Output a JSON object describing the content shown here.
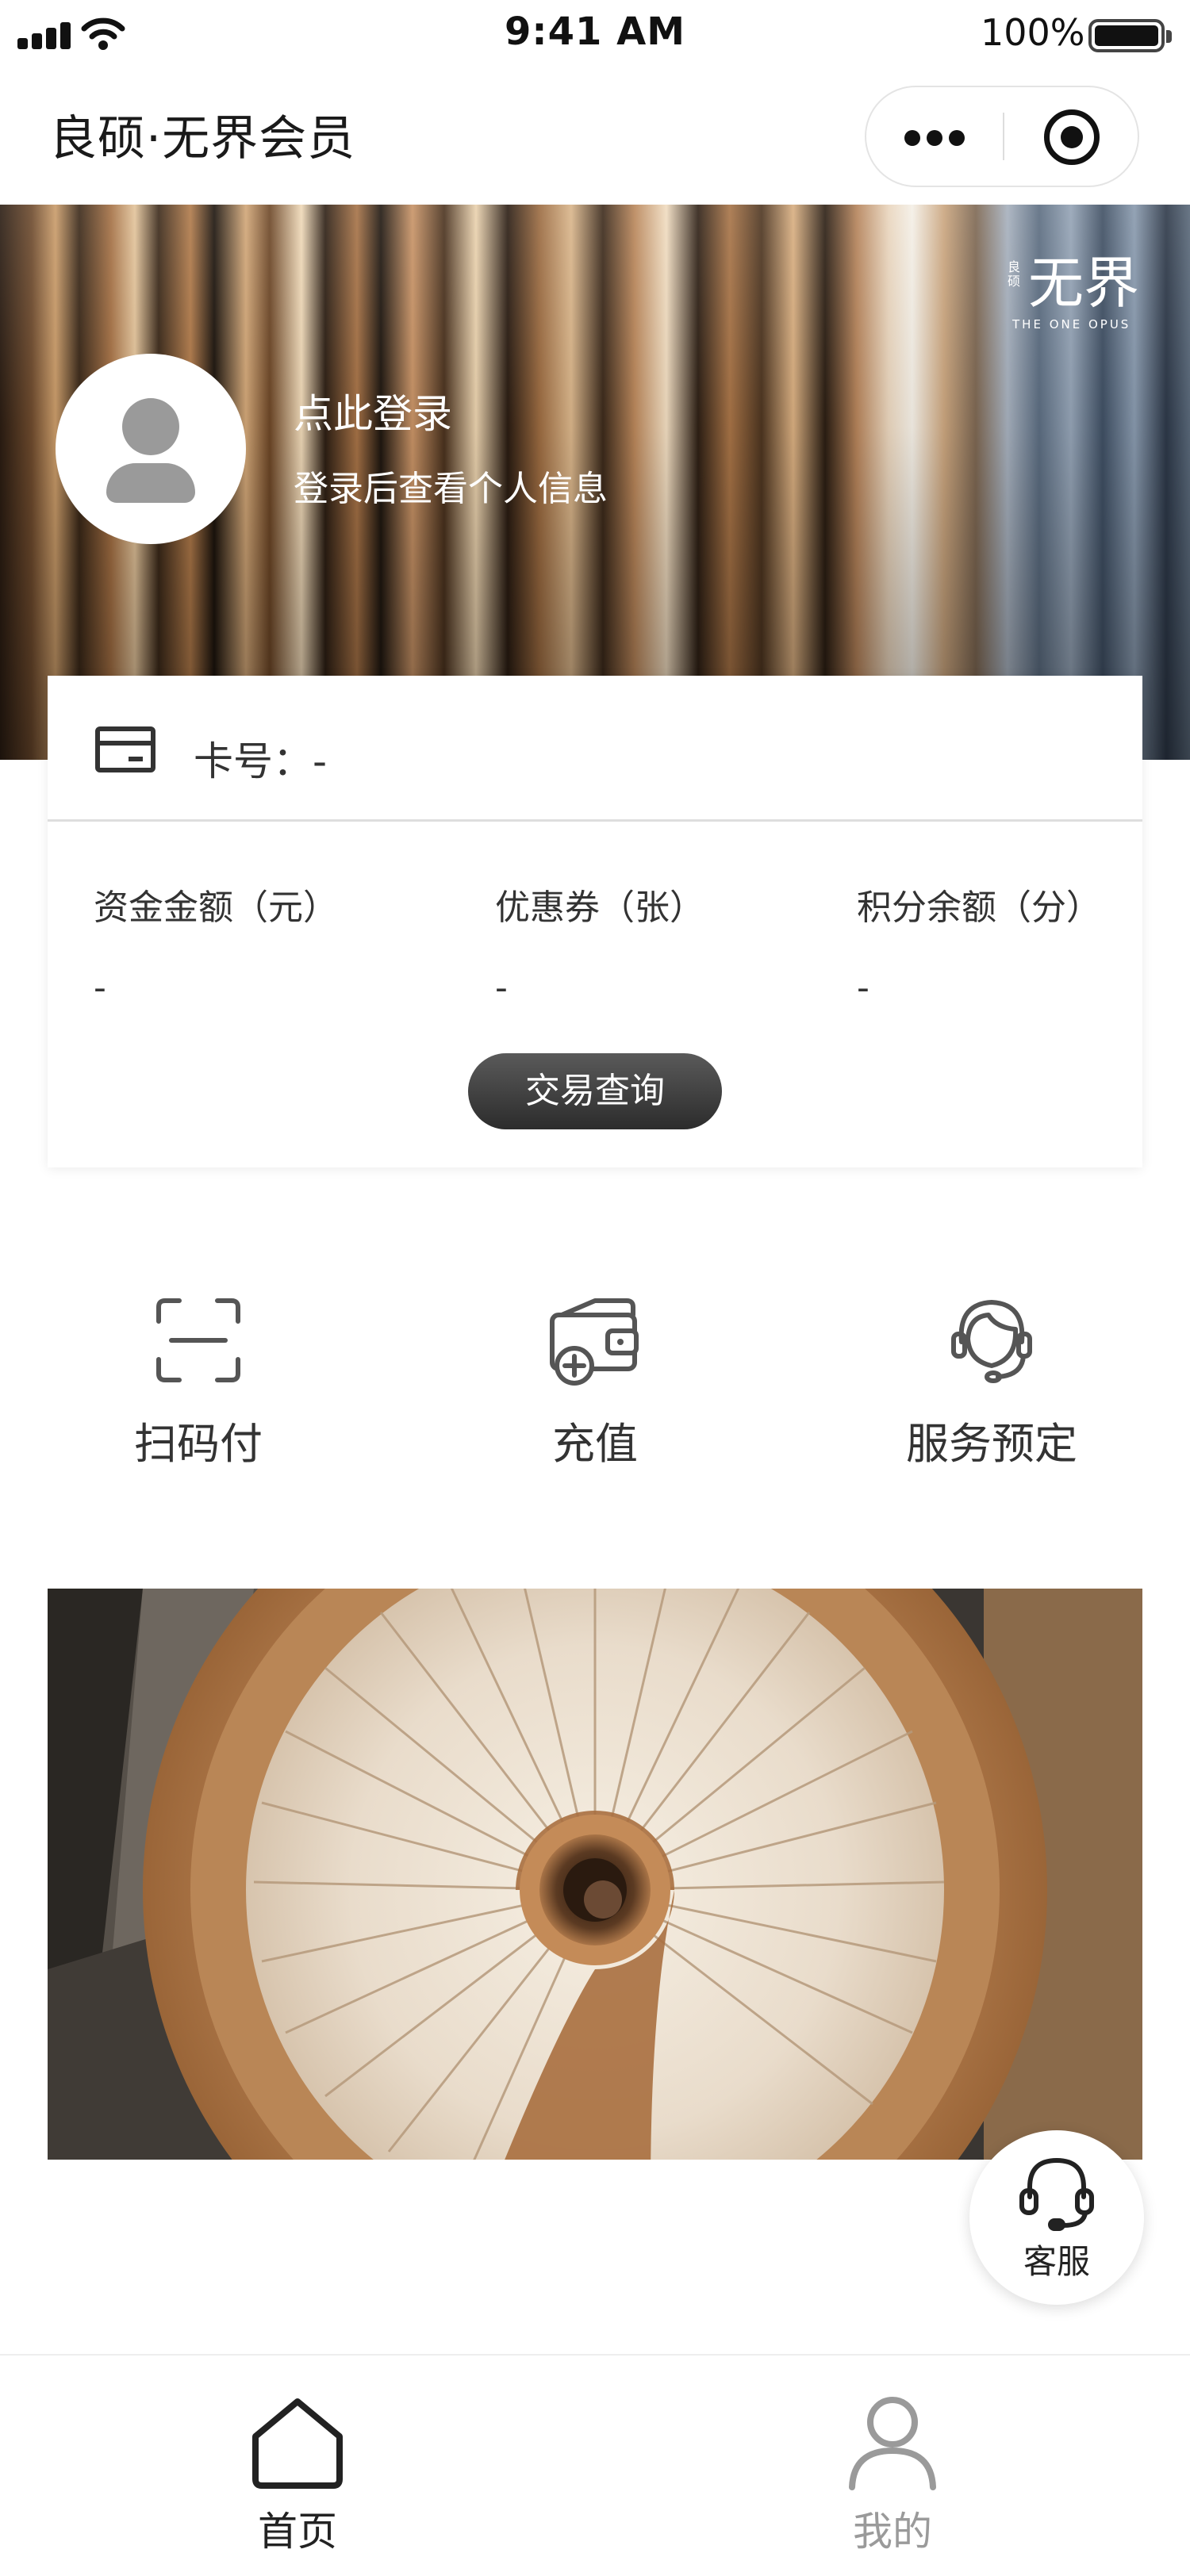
{
  "status_bar": {
    "time": "9:41 AM",
    "battery_text": "100%",
    "icons": [
      "signal-icon",
      "wifi-icon",
      "battery-icon"
    ]
  },
  "nav": {
    "title": "良硕·无界会员",
    "capsule_icons": [
      "more-icon",
      "close-icon"
    ]
  },
  "hero": {
    "logo_small": "良硕",
    "logo_main": "无界",
    "logo_sub": "THE ONE OPUS",
    "login_title": "点此登录",
    "login_sub": "登录后查看个人信息"
  },
  "card": {
    "card_no": "卡号：-",
    "stats": [
      {
        "label": "资金金额（元）",
        "value": "-"
      },
      {
        "label": "优惠券（张）",
        "value": "-"
      },
      {
        "label": "积分余额（分）",
        "value": "-"
      }
    ],
    "txn_button": "交易查询"
  },
  "actions": [
    {
      "label": "扫码付",
      "icon": "scan-icon"
    },
    {
      "label": "充值",
      "icon": "wallet-add-icon"
    },
    {
      "label": "服务预定",
      "icon": "service-agent-icon"
    }
  ],
  "customer_service": {
    "label": "客服",
    "icon": "headset-icon"
  },
  "tabs": [
    {
      "label": "首页",
      "icon": "home-icon",
      "active": true
    },
    {
      "label": "我的",
      "icon": "user-icon",
      "active": false
    }
  ],
  "colors": {
    "tab_active": "#222222",
    "tab_inactive": "#9a9a9a",
    "button_dark": "#3a3a3a",
    "icon_gray": "#555555"
  }
}
